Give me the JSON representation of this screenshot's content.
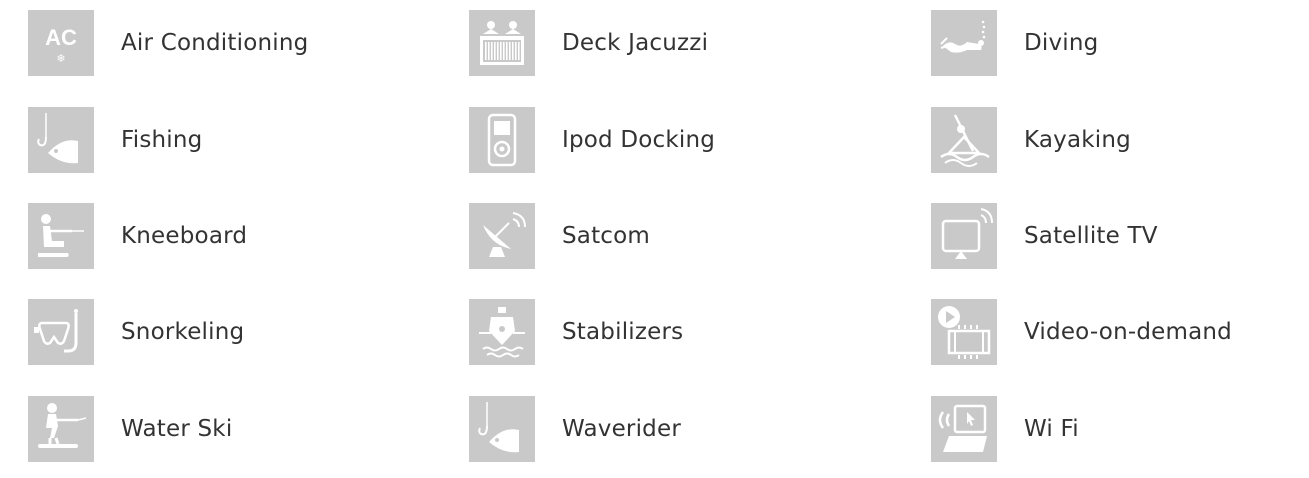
{
  "amenities": [
    {
      "label": "Air Conditioning",
      "icon": "air-conditioning-icon"
    },
    {
      "label": "Deck Jacuzzi",
      "icon": "deck-jacuzzi-icon"
    },
    {
      "label": "Diving",
      "icon": "diving-icon"
    },
    {
      "label": "Fishing",
      "icon": "fishing-icon"
    },
    {
      "label": "Ipod Docking",
      "icon": "ipod-docking-icon"
    },
    {
      "label": "Kayaking",
      "icon": "kayaking-icon"
    },
    {
      "label": "Kneeboard",
      "icon": "kneeboard-icon"
    },
    {
      "label": "Satcom",
      "icon": "satcom-icon"
    },
    {
      "label": "Satellite TV",
      "icon": "satellite-tv-icon"
    },
    {
      "label": "Snorkeling",
      "icon": "snorkeling-icon"
    },
    {
      "label": "Stabilizers",
      "icon": "stabilizers-icon"
    },
    {
      "label": "Video-on-demand",
      "icon": "video-on-demand-icon"
    },
    {
      "label": "Water Ski",
      "icon": "water-ski-icon"
    },
    {
      "label": "Waverider",
      "icon": "waverider-icon"
    },
    {
      "label": "Wi Fi",
      "icon": "wifi-icon"
    }
  ],
  "icon_text": {
    "ac": "AC",
    "ac_snow": "❄"
  },
  "colors": {
    "icon_bg": "#c9c9c9",
    "icon_fg": "#ffffff",
    "text": "#333333"
  }
}
